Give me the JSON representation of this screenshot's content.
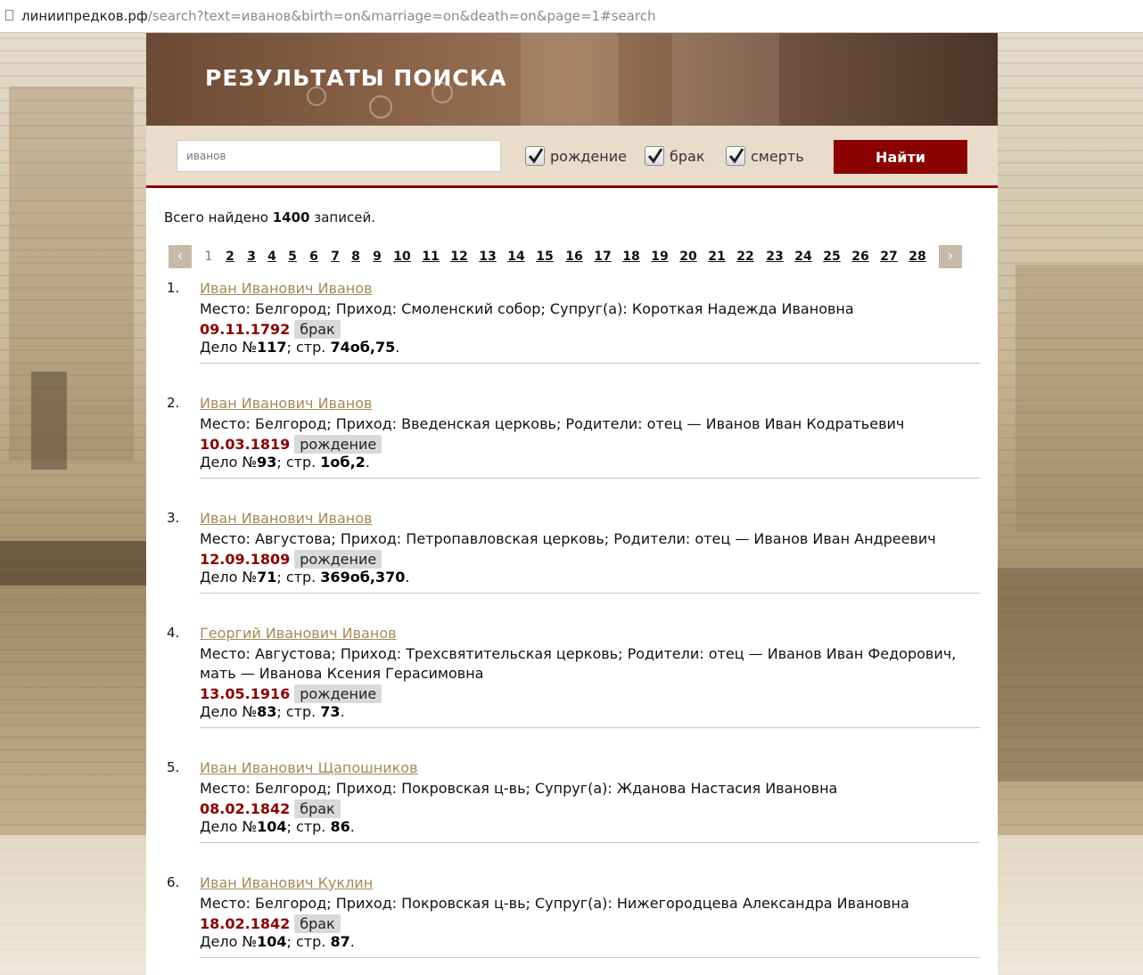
{
  "url": {
    "domain": "линиипредков.рф",
    "rest": "/search?text=иванов&birth=on&marriage=on&death=on&page=1#search"
  },
  "header": {
    "title": "РЕЗУЛЬТАТЫ ПОИСКА"
  },
  "search": {
    "query": "иванов",
    "filters": [
      {
        "label": "рождение",
        "checked": true
      },
      {
        "label": "брак",
        "checked": true
      },
      {
        "label": "смерть",
        "checked": true
      }
    ],
    "button_label": "Найти"
  },
  "summary": {
    "prefix": "Всего найдено",
    "count": "1400",
    "suffix": "записей."
  },
  "pagination": {
    "prev": "‹",
    "next": "›",
    "current": 1,
    "pages": [
      "1",
      "2",
      "3",
      "4",
      "5",
      "6",
      "7",
      "8",
      "9",
      "10",
      "11",
      "12",
      "13",
      "14",
      "15",
      "16",
      "17",
      "18",
      "19",
      "20",
      "21",
      "22",
      "23",
      "24",
      "25",
      "26",
      "27",
      "28"
    ]
  },
  "records": [
    {
      "num": "1.",
      "name": "Иван Иванович Иванов",
      "place": "Место: Белгород; Приход: Смоленский собор; Супруг(а): Короткая Надежда Ивановна",
      "date": "09.11.1792",
      "type": "брак",
      "case_prefix": "Дело №",
      "case_no": "117",
      "page_prefix": "; стр.",
      "page_no": "74об,75",
      "end": "."
    },
    {
      "num": "2.",
      "name": "Иван Иванович Иванов",
      "place": "Место: Белгород; Приход: Введенская церковь; Родители: отец — Иванов Иван Кодратьевич",
      "date": "10.03.1819",
      "type": "рождение",
      "case_prefix": "Дело №",
      "case_no": "93",
      "page_prefix": "; стр.",
      "page_no": "1об,2",
      "end": "."
    },
    {
      "num": "3.",
      "name": "Иван Иванович Иванов",
      "place": "Место: Августова; Приход: Петропавловская церковь; Родители: отец — Иванов Иван Андреевич",
      "date": "12.09.1809",
      "type": "рождение",
      "case_prefix": "Дело №",
      "case_no": "71",
      "page_prefix": "; стр.",
      "page_no": "369об,370",
      "end": "."
    },
    {
      "num": "4.",
      "name": "Георгий Иванович Иванов",
      "place": "Место: Августова; Приход: Трехсвятительская церковь; Родители: отец — Иванов Иван Федорович, мать — Иванова Ксения Герасимовна",
      "date": "13.05.1916",
      "type": "рождение",
      "case_prefix": "Дело №",
      "case_no": "83",
      "page_prefix": "; стр.",
      "page_no": "73",
      "end": "."
    },
    {
      "num": "5.",
      "name": "Иван Иванович Щапошников",
      "place": "Место: Белгород; Приход: Покровская ц-вь; Супруг(а): Жданова Настасия Ивановна",
      "date": "08.02.1842",
      "type": "брак",
      "case_prefix": "Дело №",
      "case_no": "104",
      "page_prefix": "; стр.",
      "page_no": "86",
      "end": "."
    },
    {
      "num": "6.",
      "name": "Иван Иванович Куклин",
      "place": "Место: Белгород; Приход: Покровская ц-вь; Супруг(а): Нижегородцева Александра Ивановна",
      "date": "18.02.1842",
      "type": "брак",
      "case_prefix": "Дело №",
      "case_no": "104",
      "page_prefix": "; стр.",
      "page_no": "87",
      "end": "."
    }
  ]
}
